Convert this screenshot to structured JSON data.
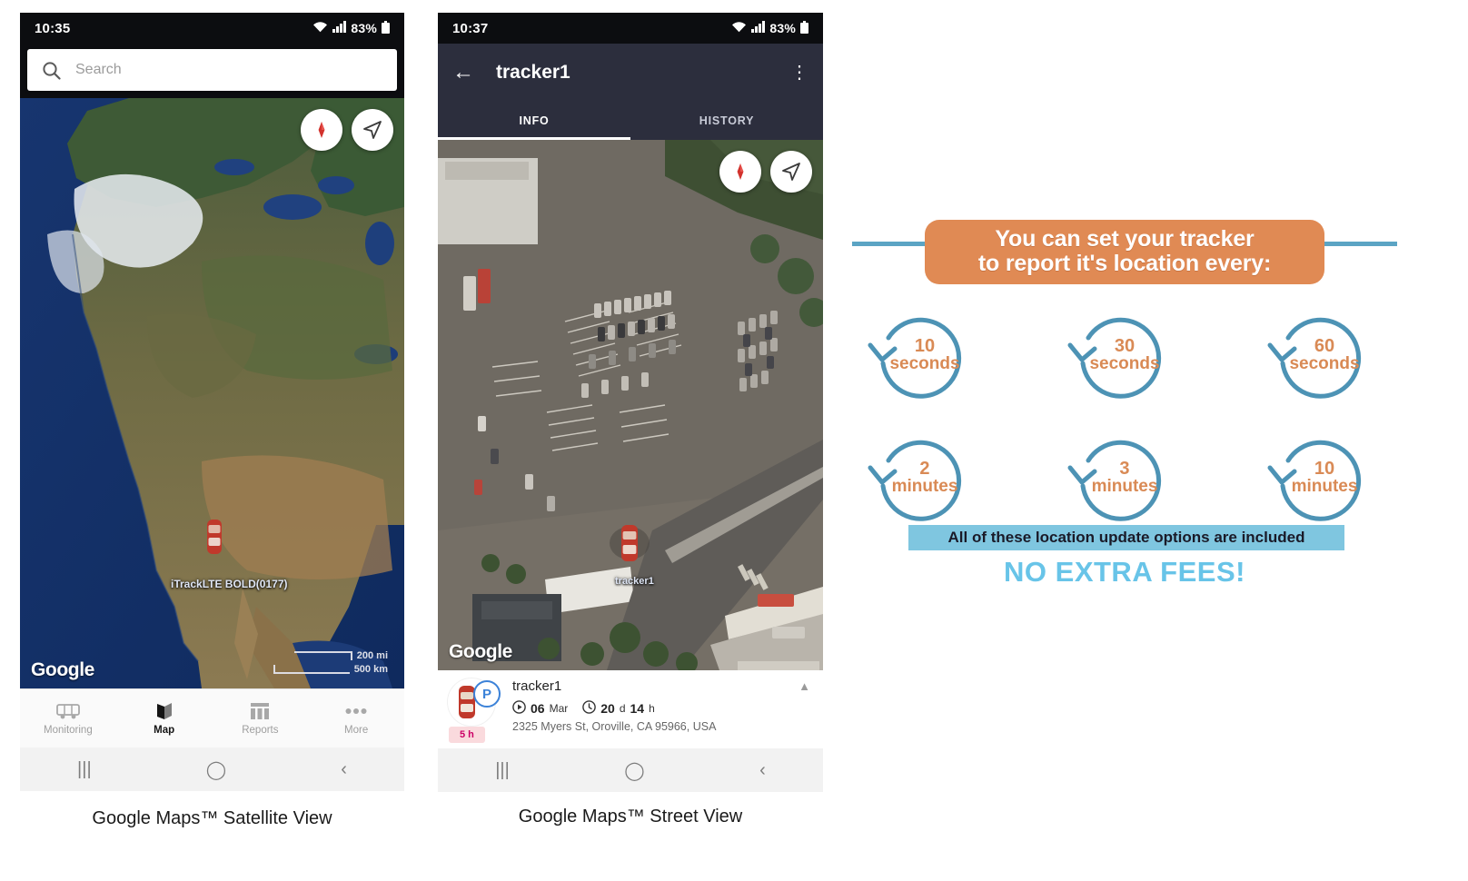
{
  "phone1": {
    "status": {
      "time": "10:35",
      "battery": "83%",
      "wifi_icon": "wifi-icon",
      "signal_icon": "signal-icon",
      "battery_icon": "battery-icon"
    },
    "search": {
      "placeholder": "Search",
      "value": "",
      "icon": "search-icon"
    },
    "map": {
      "attribution": "Google",
      "scale_miles": "200 mi",
      "scale_km": "500 km",
      "marker_label": "iTrackLTE BOLD(0177)",
      "compass_icon": "compass-icon",
      "locate_icon": "navigate-arrow-icon"
    },
    "bottom_nav": [
      {
        "label": "Monitoring",
        "icon": "van-icon",
        "active": false
      },
      {
        "label": "Map",
        "icon": "map-icon",
        "active": true
      },
      {
        "label": "Reports",
        "icon": "reports-icon",
        "active": false
      },
      {
        "label": "More",
        "icon": "more-dots-icon",
        "active": false
      }
    ],
    "system_nav": [
      {
        "icon": "recents-icon",
        "glyph": "|||"
      },
      {
        "icon": "home-icon",
        "glyph": "◯"
      },
      {
        "icon": "back-icon",
        "glyph": "‹"
      }
    ],
    "caption": "Google Maps™ Satellite View"
  },
  "phone2": {
    "status": {
      "time": "10:37",
      "battery": "83%"
    },
    "appbar": {
      "back_icon": "back-arrow-icon",
      "title": "tracker1",
      "menu_icon": "overflow-menu-icon"
    },
    "tabs": [
      {
        "label": "INFO",
        "active": true
      },
      {
        "label": "HISTORY",
        "active": false
      }
    ],
    "map": {
      "attribution": "Google",
      "marker_label": "tracker1",
      "compass_icon": "compass-icon",
      "locate_icon": "navigate-arrow-icon"
    },
    "info_card": {
      "vehicle_icon": "car-icon",
      "park_badge": "P",
      "name": "tracker1",
      "date_icon": "play-circle-icon",
      "date_value": "06",
      "date_unit": "Mar",
      "duration_icon": "clock-icon",
      "duration_days": "20",
      "duration_days_unit": "d",
      "duration_hours": "14",
      "duration_hours_unit": "h",
      "address": "2325 Myers St, Oroville, CA 95966, USA",
      "history_badge": "5 h",
      "collapse_icon": "chevron-up-icon"
    },
    "caption": "Google Maps™ Street View"
  },
  "infographic": {
    "headline_line1": "You can set your tracker",
    "headline_line2": "to report it's location every:",
    "intervals": [
      {
        "num": "10",
        "unit": "seconds"
      },
      {
        "num": "30",
        "unit": "seconds"
      },
      {
        "num": "60",
        "unit": "seconds"
      },
      {
        "num": "2",
        "unit": "minutes"
      },
      {
        "num": "3",
        "unit": "minutes"
      },
      {
        "num": "10",
        "unit": "minutes"
      }
    ],
    "included_text": "All of these location update options are included",
    "no_fees_text": "NO EXTRA FEES!",
    "colors": {
      "banner_bg": "#e08a54",
      "rule": "#5ba4c4",
      "circle_stroke": "#4d93b5",
      "interval_text": "#d98a55",
      "included_bg": "#7fc6e0",
      "no_fees": "#68c4e8"
    }
  }
}
